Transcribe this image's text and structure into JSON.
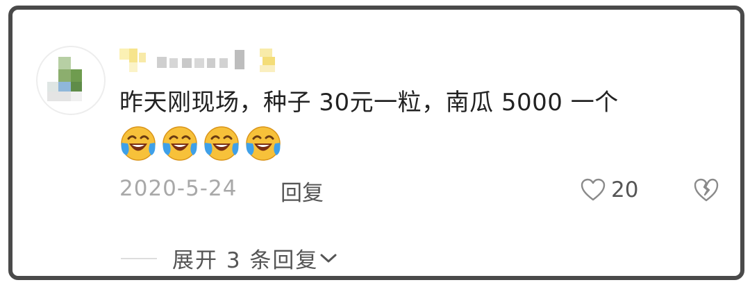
{
  "comment": {
    "text": "昨天刚现场，种子 30元一粒，南瓜 5000 一个",
    "emoji_name": "laughing-crying-emoji",
    "emoji_count": 4
  },
  "meta": {
    "date": "2020-5-24",
    "reply_label": "回复",
    "like_count": "20"
  },
  "replies": {
    "expand_label": "展开 3 条回复"
  },
  "colors": {
    "frame": "#4a4a4a",
    "text": "#222222",
    "muted": "#a8a8a8",
    "action": "#555555",
    "emoji_face": "#f7c13a",
    "emoji_tear": "#3fa0e8"
  }
}
